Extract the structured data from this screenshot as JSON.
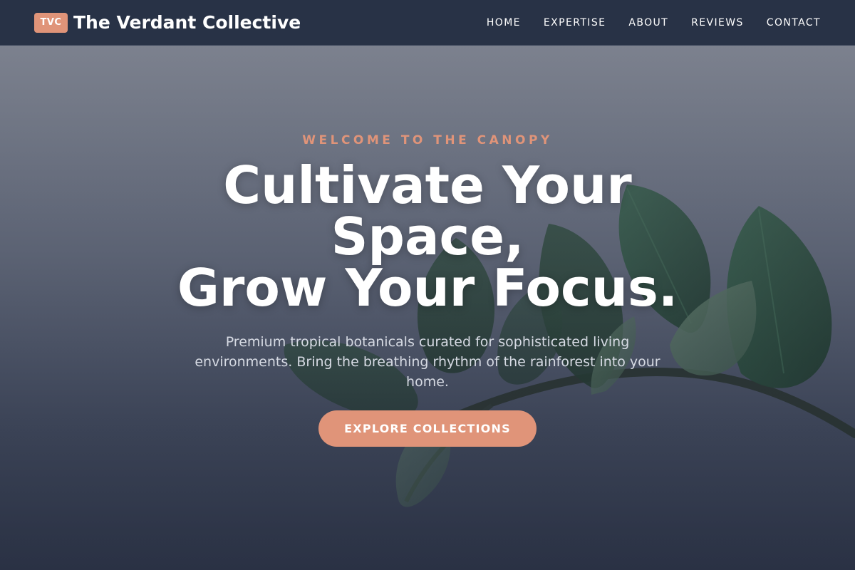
{
  "header": {
    "badge": "TVC",
    "brand_name": "The Verdant Collective",
    "nav": [
      {
        "label": "HOME"
      },
      {
        "label": "EXPERTISE"
      },
      {
        "label": "ABOUT"
      },
      {
        "label": "REVIEWS"
      },
      {
        "label": "CONTACT"
      }
    ]
  },
  "hero": {
    "eyebrow": "WELCOME TO THE CANOPY",
    "headline_line1": "Cultivate Your",
    "headline_line2": "Space,",
    "headline_line3": "Grow Your Focus.",
    "subtitle": "Premium tropical botanicals curated for sophisticated living environments. Bring the breathing rhythm of the rainforest into your home.",
    "cta_label": "EXPLORE COLLECTIONS"
  },
  "colors": {
    "accent": "#e09479",
    "header_bg": "#283246",
    "text_light": "#ffffff",
    "subtitle_text": "#d6dae3"
  },
  "icons": {
    "hero_background": "plant-leaves-image"
  }
}
